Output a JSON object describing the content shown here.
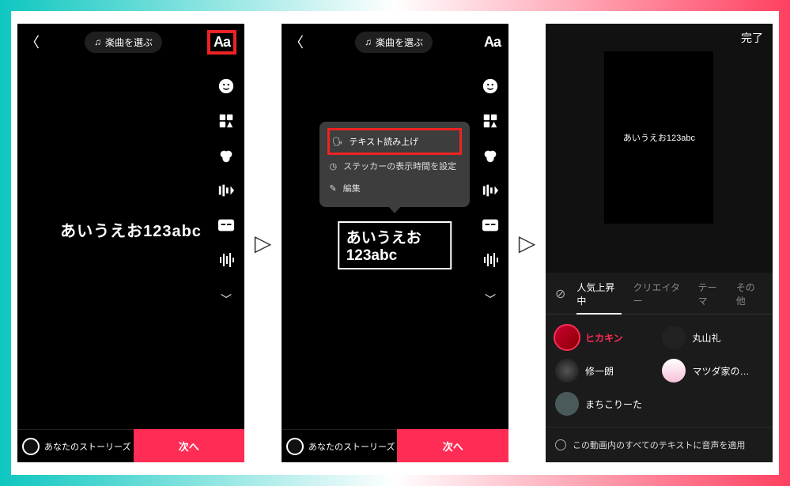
{
  "music_pill_label": "楽曲を選ぶ",
  "text_tool_label": "Aa",
  "sample_text": "あいうえお123abc",
  "stories_label": "あなたのストーリーズ",
  "next_label": "次へ",
  "arrow_glyph": "▷",
  "popup": {
    "tts": "テキスト読み上げ",
    "duration": "ステッカーの表示時間を設定",
    "edit": "編集"
  },
  "screen3": {
    "done": "完了",
    "preview_text": "あいうえお123abc",
    "tabs": {
      "trending": "人気上昇中",
      "creator": "クリエイター",
      "theme": "テーマ",
      "other": "その他"
    },
    "voices": [
      {
        "name": "ヒカキン",
        "selected": true
      },
      {
        "name": "丸山礼",
        "selected": false
      },
      {
        "name": "修一朗",
        "selected": false
      },
      {
        "name": "マツダ家の…",
        "selected": false
      },
      {
        "name": "まちこりーた",
        "selected": false
      }
    ],
    "apply_all": "この動画内のすべてのテキストに音声を適用"
  }
}
